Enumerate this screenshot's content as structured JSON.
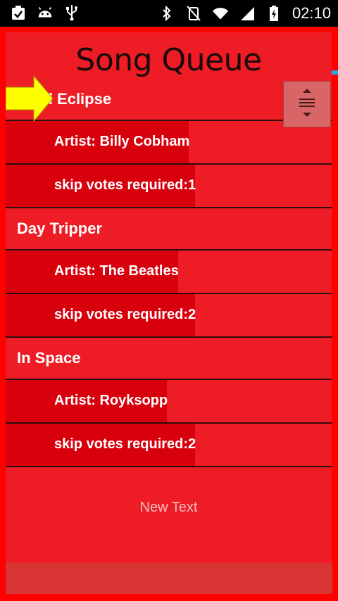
{
  "status_bar": {
    "time": "02:10"
  },
  "panel": {
    "title": "Song Queue",
    "footer_text": "New Text"
  },
  "songs": [
    {
      "title": "Total Eclipse",
      "artist": "Artist: Billy Cobham",
      "skip": "skip votes required:1"
    },
    {
      "title": "Day Tripper",
      "artist": "Artist: The Beatles",
      "skip": "skip votes required:2"
    },
    {
      "title": "In Space",
      "artist": "Artist: Royksopp",
      "skip": "skip votes required:2"
    }
  ],
  "colors": {
    "panel": "#ee1c25",
    "row_highlight": "#d9000d",
    "background": "#ff0000",
    "arrow": "#ffff00"
  }
}
